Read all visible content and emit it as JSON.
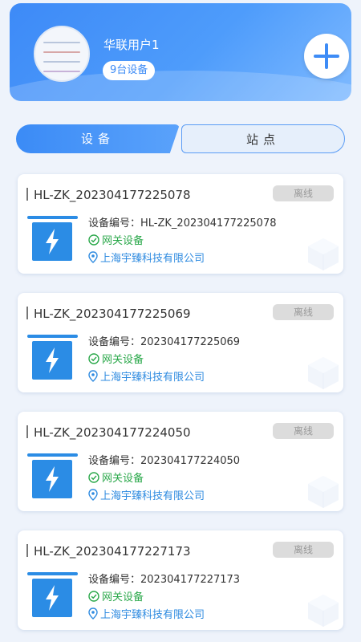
{
  "header": {
    "username": "华联用户1",
    "device_count": "9台设备"
  },
  "tabs": [
    {
      "label": "设备",
      "active": true
    },
    {
      "label": "站点",
      "active": false
    }
  ],
  "devices": [
    {
      "title": "HL-ZK_202304177225078",
      "status": "离线",
      "code_label": "设备编号：",
      "code": "HL-ZK_202304177225078",
      "type": "网关设备",
      "company": "上海宇臻科技有限公司"
    },
    {
      "title": "HL-ZK_202304177225069",
      "status": "离线",
      "code_label": "设备编号：",
      "code": "202304177225069",
      "type": "网关设备",
      "company": "上海宇臻科技有限公司"
    },
    {
      "title": "HL-ZK_202304177224050",
      "status": "离线",
      "code_label": "设备编号：",
      "code": "202304177224050",
      "type": "网关设备",
      "company": "上海宇臻科技有限公司"
    },
    {
      "title": "HL-ZK_202304177227173",
      "status": "离线",
      "code_label": "设备编号：",
      "code": "202304177227173",
      "type": "网关设备",
      "company": "上海宇臻科技有限公司"
    }
  ],
  "colors": {
    "accent": "#3e8cf6",
    "online_green": "#2aa84a",
    "location_blue": "#2f8be0",
    "status_gray": "#dcdcdc"
  },
  "icons": {
    "add": "plus-icon",
    "device": "lightning-bolt-icon",
    "type": "check-circle-icon",
    "location": "location-pin-icon"
  }
}
